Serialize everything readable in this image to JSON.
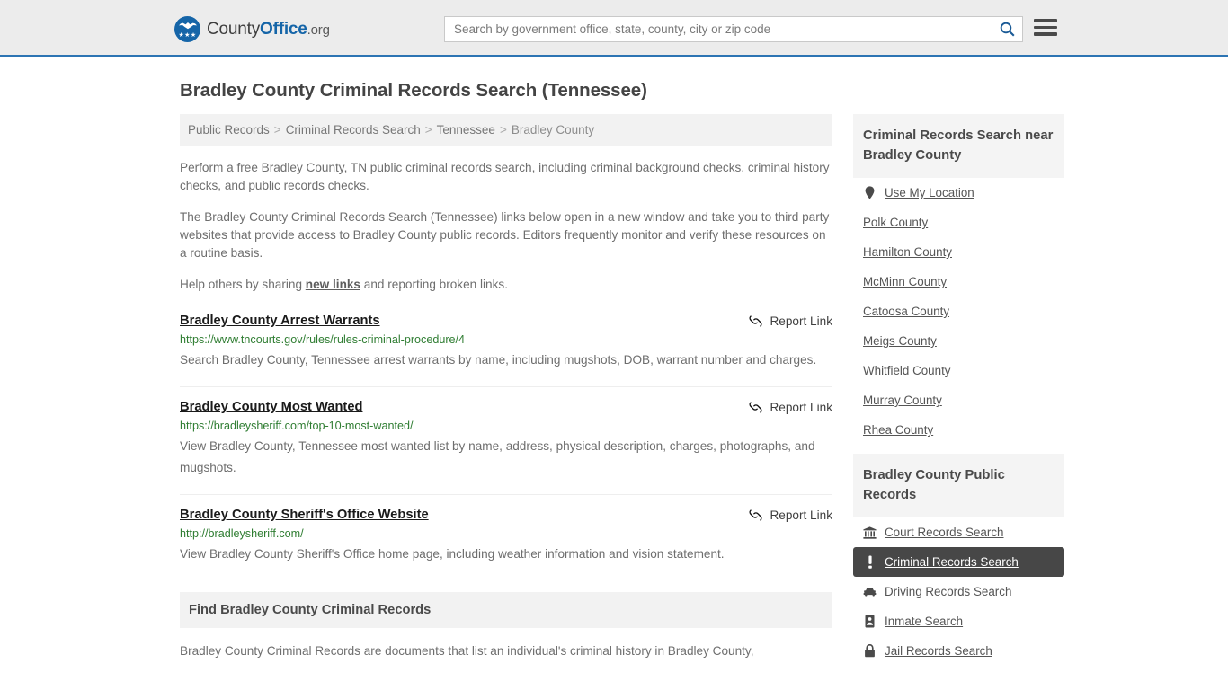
{
  "header": {
    "brand": {
      "part1": "County",
      "part2": "Office",
      "part3": ".org",
      "logo_icon": "eagle-seal-icon",
      "stars": "★★★"
    },
    "search": {
      "placeholder": "Search by government office, state, county, city or zip code",
      "value": "",
      "search_icon": "search-icon"
    },
    "menu_icon": "hamburger-menu-icon",
    "accent_color": "#2c74b3",
    "background_color": "#ececec"
  },
  "page": {
    "title": "Bradley County Criminal Records Search (Tennessee)"
  },
  "breadcrumb": {
    "separator": ">",
    "items": [
      {
        "label": "Public Records",
        "current": false
      },
      {
        "label": "Criminal Records Search",
        "current": false
      },
      {
        "label": "Tennessee",
        "current": false
      },
      {
        "label": "Bradley County",
        "current": true
      }
    ]
  },
  "intro": {
    "paragraph1": "Perform a free Bradley County, TN public criminal records search, including criminal background checks, criminal history checks, and public records checks.",
    "paragraph2": "The Bradley County Criminal Records Search (Tennessee) links below open in a new window and take you to third party websites that provide access to Bradley County public records. Editors frequently monitor and verify these resources on a routine basis.",
    "paragraph3_before": "Help others by sharing ",
    "paragraph3_link": "new links",
    "paragraph3_after": " and reporting broken links."
  },
  "results": {
    "report_label": "Report Link",
    "report_icon": "broken-link-icon",
    "items": [
      {
        "title": "Bradley County Arrest Warrants",
        "url": "https://www.tncourts.gov/rules/rules-criminal-procedure/4",
        "description": "Search Bradley County, Tennessee arrest warrants by name, including mugshots, DOB, warrant number and charges."
      },
      {
        "title": "Bradley County Most Wanted",
        "url": "https://bradleysheriff.com/top-10-most-wanted/",
        "description": "View Bradley County, Tennessee most wanted list by name, address, physical description, charges, photographs, and mugshots."
      },
      {
        "title": "Bradley County Sheriff's Office Website",
        "url": "http://bradleysheriff.com/",
        "description": "View Bradley County Sheriff's Office home page, including weather information and vision statement."
      }
    ]
  },
  "find_section": {
    "heading": "Find Bradley County Criminal Records",
    "body": "Bradley County Criminal Records are documents that list an individual's criminal history in Bradley County,"
  },
  "sidebar": {
    "panels": [
      {
        "title": "Criminal Records Search near Bradley County",
        "items": [
          {
            "label": "Use My Location",
            "icon": "map-pin-icon",
            "active": false
          },
          {
            "label": "Polk County",
            "icon": "",
            "active": false
          },
          {
            "label": "Hamilton County",
            "icon": "",
            "active": false
          },
          {
            "label": "McMinn County",
            "icon": "",
            "active": false
          },
          {
            "label": "Catoosa County",
            "icon": "",
            "active": false
          },
          {
            "label": "Meigs County",
            "icon": "",
            "active": false
          },
          {
            "label": "Whitfield County",
            "icon": "",
            "active": false
          },
          {
            "label": "Murray County",
            "icon": "",
            "active": false
          },
          {
            "label": "Rhea County",
            "icon": "",
            "active": false
          }
        ]
      },
      {
        "title": "Bradley County Public Records",
        "items": [
          {
            "label": "Court Records Search",
            "icon": "courthouse-icon",
            "active": false
          },
          {
            "label": "Criminal Records Search",
            "icon": "exclamation-icon",
            "active": true
          },
          {
            "label": "Driving Records Search",
            "icon": "car-icon",
            "active": false
          },
          {
            "label": "Inmate Search",
            "icon": "id-card-icon",
            "active": false
          },
          {
            "label": "Jail Records Search",
            "icon": "lock-icon",
            "active": false
          }
        ]
      }
    ],
    "active_background_color": "#474747"
  }
}
